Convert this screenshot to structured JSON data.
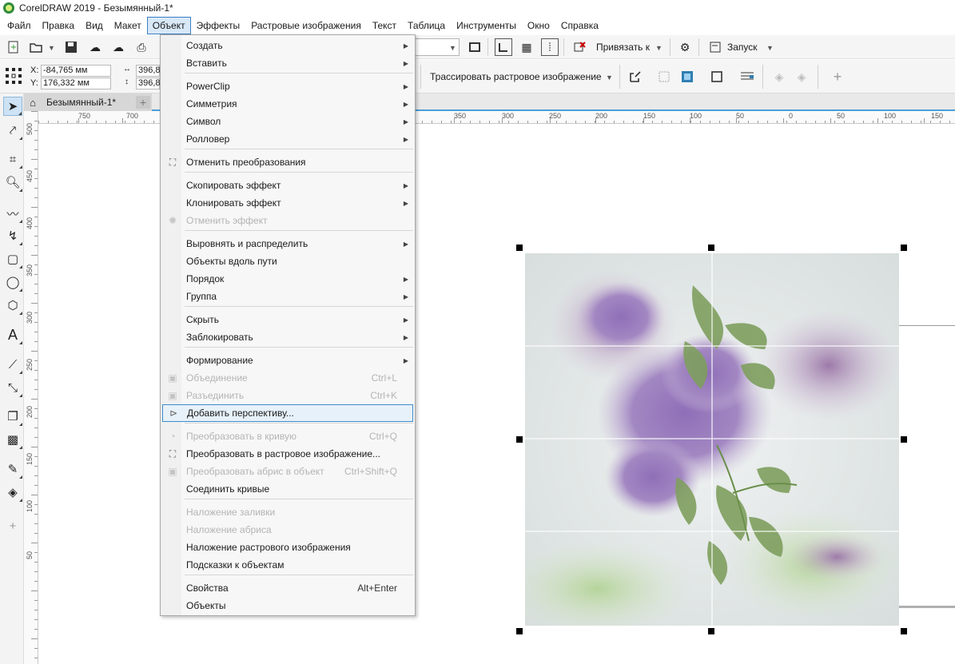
{
  "window": {
    "title": "CorelDRAW 2019 - Безымянный-1*"
  },
  "menubar": [
    {
      "label": "Файл",
      "active": false
    },
    {
      "label": "Правка",
      "active": false
    },
    {
      "label": "Вид",
      "active": false
    },
    {
      "label": "Макет",
      "active": false
    },
    {
      "label": "Объект",
      "active": true
    },
    {
      "label": "Эффекты",
      "active": false
    },
    {
      "label": "Растровые изображения",
      "active": false
    },
    {
      "label": "Текст",
      "active": false
    },
    {
      "label": "Таблица",
      "active": false
    },
    {
      "label": "Инструменты",
      "active": false
    },
    {
      "label": "Окно",
      "active": false
    },
    {
      "label": "Справка",
      "active": false
    }
  ],
  "toolbar": {
    "snap_label": "Привязать к",
    "launch_label": "Запуск",
    "trace_label": "Трассировать растровое изображение"
  },
  "property_bar": {
    "x_label": "X:",
    "y_label": "Y:",
    "x_value": "-84,765 мм",
    "y_value": "176,332 мм",
    "w_value": "396,8",
    "h_value": "396,8"
  },
  "document_tab": {
    "name": "Безымянный-1*",
    "add_label": "+"
  },
  "ruler": {
    "h_labels": [
      "750",
      "700",
      "350",
      "300",
      "250",
      "200",
      "150",
      "100",
      "50",
      "0",
      "50",
      "100",
      "150"
    ],
    "v_labels": [
      "500",
      "450",
      "400",
      "350",
      "300",
      "250",
      "200",
      "150",
      "100",
      "50"
    ]
  },
  "object_menu": {
    "items": [
      {
        "label": "Создать",
        "submenu": true,
        "disabled": false,
        "shortcut": ""
      },
      {
        "label": "Вставить",
        "submenu": true,
        "disabled": false,
        "shortcut": ""
      },
      {
        "label": "PowerClip",
        "submenu": true,
        "disabled": false,
        "shortcut": ""
      },
      {
        "label": "Симметрия",
        "submenu": true,
        "disabled": false,
        "shortcut": ""
      },
      {
        "label": "Символ",
        "submenu": true,
        "disabled": false,
        "shortcut": ""
      },
      {
        "label": "Ролловер",
        "submenu": true,
        "disabled": false,
        "shortcut": ""
      },
      {
        "label": "Отменить преобразования",
        "submenu": false,
        "disabled": false,
        "shortcut": "",
        "icon": "clear-transform-icon"
      },
      {
        "label": "Скопировать эффект",
        "submenu": true,
        "disabled": false,
        "shortcut": ""
      },
      {
        "label": "Клонировать эффект",
        "submenu": true,
        "disabled": false,
        "shortcut": ""
      },
      {
        "label": "Отменить эффект",
        "submenu": false,
        "disabled": true,
        "shortcut": "",
        "icon": "clear-effect-icon"
      },
      {
        "label": "Выровнять и распределить",
        "submenu": true,
        "disabled": false,
        "shortcut": ""
      },
      {
        "label": "Объекты вдоль пути",
        "submenu": false,
        "disabled": false,
        "shortcut": ""
      },
      {
        "label": "Порядок",
        "submenu": true,
        "disabled": false,
        "shortcut": ""
      },
      {
        "label": "Группа",
        "submenu": true,
        "disabled": false,
        "shortcut": ""
      },
      {
        "label": "Скрыть",
        "submenu": true,
        "disabled": false,
        "shortcut": ""
      },
      {
        "label": "Заблокировать",
        "submenu": true,
        "disabled": false,
        "shortcut": ""
      },
      {
        "label": "Формирование",
        "submenu": true,
        "disabled": false,
        "shortcut": ""
      },
      {
        "label": "Объединение",
        "submenu": false,
        "disabled": true,
        "shortcut": "Ctrl+L",
        "icon": "combine-icon"
      },
      {
        "label": "Разъединить",
        "submenu": false,
        "disabled": true,
        "shortcut": "Ctrl+K",
        "icon": "break-apart-icon"
      },
      {
        "label": "Добавить перспективу...",
        "submenu": false,
        "disabled": false,
        "shortcut": "",
        "highlight": true,
        "icon": "perspective-icon"
      },
      {
        "label": "Преобразовать в кривую",
        "submenu": false,
        "disabled": true,
        "shortcut": "Ctrl+Q",
        "icon": "convert-curve-icon"
      },
      {
        "label": "Преобразовать в растровое изображение...",
        "submenu": false,
        "disabled": false,
        "shortcut": "",
        "icon": "convert-bitmap-icon"
      },
      {
        "label": "Преобразовать абрис в объект",
        "submenu": false,
        "disabled": true,
        "shortcut": "Ctrl+Shift+Q",
        "icon": "outline-object-icon"
      },
      {
        "label": "Соединить кривые",
        "submenu": false,
        "disabled": false,
        "shortcut": ""
      },
      {
        "label": "Наложение заливки",
        "submenu": false,
        "disabled": true,
        "shortcut": ""
      },
      {
        "label": "Наложение абриса",
        "submenu": false,
        "disabled": true,
        "shortcut": ""
      },
      {
        "label": "Наложение растрового изображения",
        "submenu": false,
        "disabled": false,
        "shortcut": ""
      },
      {
        "label": "Подсказки к объектам",
        "submenu": false,
        "disabled": false,
        "shortcut": ""
      },
      {
        "label": "Свойства",
        "submenu": false,
        "disabled": false,
        "shortcut": "Alt+Enter"
      },
      {
        "label": "Объекты",
        "submenu": false,
        "disabled": false,
        "shortcut": ""
      }
    ]
  }
}
